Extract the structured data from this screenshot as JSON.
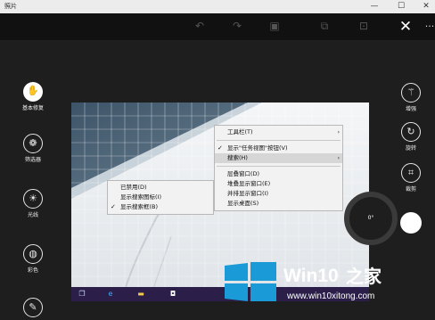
{
  "window": {
    "title": "照片",
    "minimize": "—",
    "maximize": "☐",
    "close": "✕"
  },
  "toolbar": {
    "undo": "↶",
    "redo": "↷",
    "compare": "▣",
    "copy": "⧉",
    "save": "⊡",
    "close_edit": "✕",
    "more": "···"
  },
  "left_tools": [
    {
      "label": "基本修复",
      "icon": "hand-icon",
      "glyph": "✋",
      "selected": true
    },
    {
      "label": "筛选器",
      "icon": "filter-icon",
      "glyph": "❁",
      "selected": false
    },
    {
      "label": "光线",
      "icon": "sun-icon",
      "glyph": "☀",
      "selected": false
    },
    {
      "label": "彩色",
      "icon": "palette-icon",
      "glyph": "◍",
      "selected": false
    },
    {
      "label": "",
      "icon": "brush-icon",
      "glyph": "✎",
      "selected": false
    }
  ],
  "right_tools": [
    {
      "label": "增强",
      "icon": "magic-wand-icon",
      "glyph": "⚚"
    },
    {
      "label": "旋转",
      "icon": "rotate-icon",
      "glyph": "↻"
    },
    {
      "label": "裁剪",
      "icon": "crop-icon",
      "glyph": "⌗"
    }
  ],
  "rotation": {
    "angle": "0°"
  },
  "context_menu_main": [
    {
      "label": "工具栏(T)",
      "check": false,
      "submenu": true,
      "highlighted": false
    },
    {
      "separator": true
    },
    {
      "label": "显示\"任务视图\"按钮(V)",
      "check": true,
      "submenu": false,
      "highlighted": false
    },
    {
      "label": "搜索(H)",
      "check": false,
      "submenu": true,
      "highlighted": true
    },
    {
      "separator": true
    },
    {
      "label": "层叠窗口(D)",
      "check": false,
      "submenu": false,
      "highlighted": false
    },
    {
      "label": "堆叠显示窗口(E)",
      "check": false,
      "submenu": false,
      "highlighted": false
    },
    {
      "label": "并排显示窗口(I)",
      "check": false,
      "submenu": false,
      "highlighted": false
    },
    {
      "label": "显示桌面(S)",
      "check": false,
      "submenu": false,
      "highlighted": false
    }
  ],
  "context_menu_sub": [
    {
      "label": "已禁用(D)",
      "check": false
    },
    {
      "label": "显示搜索图标(I)",
      "check": false
    },
    {
      "label": "显示搜索框(B)",
      "check": true
    }
  ],
  "watermark": {
    "brand_win": "Win10",
    "brand_cn": "之家",
    "url": "www.win10xitong.com",
    "colors": {
      "blue": "#1a9ad6",
      "white": "#ffffff"
    }
  }
}
